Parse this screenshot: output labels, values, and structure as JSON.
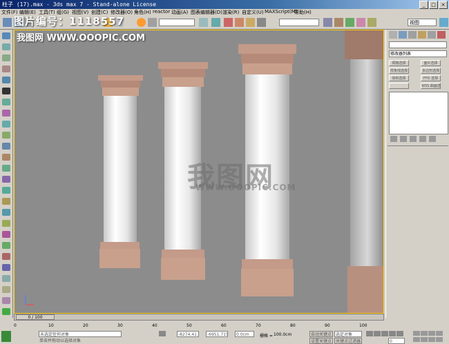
{
  "window": {
    "title": "柱子 (17).max - 3ds max 7 - Stand-alone License"
  },
  "menu": [
    "文件(F)",
    "编辑(E)",
    "工具(T)",
    "组(G)",
    "视图(V)",
    "创建(C)",
    "修改器(O)",
    "角色(H)",
    "reactor",
    "动画(A)",
    "图表编辑器(D)",
    "渲染(R)",
    "自定义(U)",
    "MAXScript(M)",
    "帮助(H)"
  ],
  "toolbar": {
    "selection_filter": "全部",
    "view_dropdown": "视图",
    "named_selection": ""
  },
  "watermark": {
    "line1": "图片编号：1118557",
    "line2": "我图网  WWW.OOOPIC.COM",
    "center_brand": "我图网",
    "center_url": "WWW.OOOPIC.COM"
  },
  "command_panel": {
    "modifier_list": "修改器列表",
    "buttons": [
      "网格选择",
      "面片选择",
      "样条线选择",
      "多边形选择",
      "体积选择",
      "FFD 选择",
      "",
      "WSS 曲面选择"
    ]
  },
  "timeline": {
    "frame_counter": "0 / 100",
    "ticks": [
      "0",
      "10",
      "20",
      "30",
      "40",
      "50",
      "60",
      "70",
      "80",
      "90",
      "100"
    ]
  },
  "status": {
    "selection": "未选定任何对象",
    "prompt": "单击并拖动以选择对象",
    "x": "-8274.41",
    "y": "-6951.715",
    "z": "0.0cm",
    "grid_label": "栅格 =",
    "grid": "100.0cm",
    "auto_key": "自动关键点",
    "set_key": "设置关键点",
    "key_filter_label": "选定对象",
    "key_filters": "关键点过滤器...",
    "frame": "0"
  },
  "colors": {
    "viewport_bg": "#8c8c8c",
    "column_base": "#c49a88",
    "title_active": "#0a246a"
  }
}
